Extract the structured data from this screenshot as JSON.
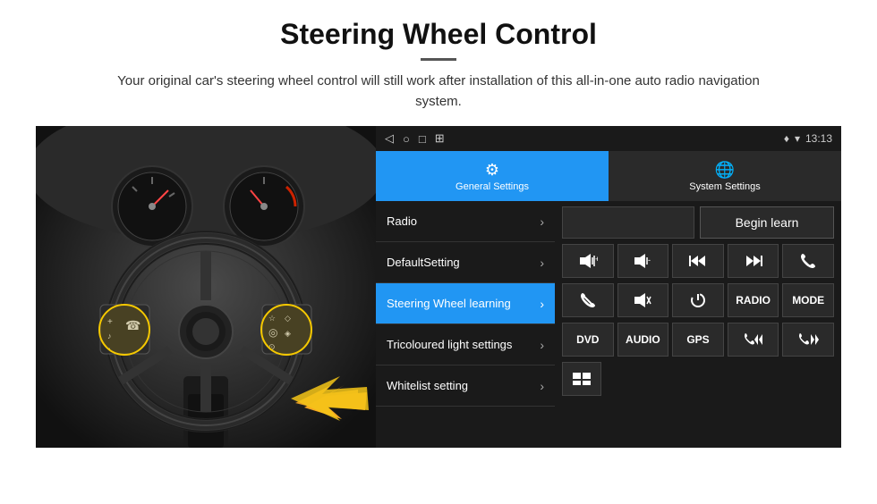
{
  "header": {
    "title": "Steering Wheel Control",
    "subtitle": "Your original car's steering wheel control will still work after installation of this all-in-one auto radio navigation system."
  },
  "status_bar": {
    "back_icon": "◁",
    "home_icon": "○",
    "square_icon": "□",
    "grid_icon": "⊞",
    "location_icon": "♦",
    "signal_icon": "▾",
    "time": "13:13"
  },
  "tabs": [
    {
      "label": "General Settings",
      "active": true
    },
    {
      "label": "System Settings",
      "active": false
    }
  ],
  "menu_items": [
    {
      "label": "Radio",
      "active": false
    },
    {
      "label": "DefaultSetting",
      "active": false
    },
    {
      "label": "Steering Wheel learning",
      "active": true
    },
    {
      "label": "Tricoloured light settings",
      "active": false
    },
    {
      "label": "Whitelist setting",
      "active": false
    }
  ],
  "right_panel": {
    "begin_learn_label": "Begin learn",
    "controls_row1": [
      {
        "icon": "🔊+",
        "label": "vol-up"
      },
      {
        "icon": "🔊-",
        "label": "vol-down"
      },
      {
        "icon": "⏮",
        "label": "prev"
      },
      {
        "icon": "⏭",
        "label": "next"
      },
      {
        "icon": "📞",
        "label": "call"
      }
    ],
    "controls_row2": [
      {
        "icon": "📞↓",
        "label": "hang-up"
      },
      {
        "icon": "🔇",
        "label": "mute"
      },
      {
        "icon": "⏻",
        "label": "power"
      },
      {
        "text": "RADIO",
        "label": "radio"
      },
      {
        "text": "MODE",
        "label": "mode"
      }
    ],
    "text_row": [
      {
        "text": "DVD",
        "label": "dvd"
      },
      {
        "text": "AUDIO",
        "label": "audio"
      },
      {
        "text": "GPS",
        "label": "gps"
      },
      {
        "icon": "📞⏮",
        "label": "call-prev"
      },
      {
        "icon": "⏭📞",
        "label": "call-next"
      }
    ],
    "bottom_icon": {
      "icon": "≡",
      "label": "menu-icon"
    }
  }
}
